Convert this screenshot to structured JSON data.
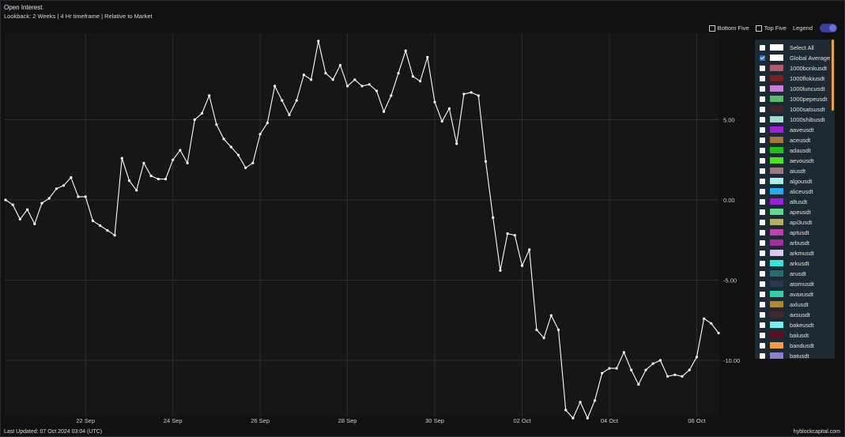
{
  "header": {
    "title": "Open Interest",
    "subtitle": "Lookback: 2 Weeks | 4 Hr timeframe | Relative to Market"
  },
  "controls": {
    "bottom_five": "Bottom Five",
    "top_five": "Top Five",
    "legend": "Legend",
    "legend_toggle_on": true
  },
  "footer": {
    "last_updated": "Last Updated: 07 Oct 2024 03:04 (UTC)",
    "brand": "hyblockcapital.com"
  },
  "legend_items": [
    {
      "label": "Select All",
      "color": "#ffffff",
      "checked": false
    },
    {
      "label": "Global Average",
      "color": "#ffffff",
      "checked": true
    },
    {
      "label": "1000bonkusdt",
      "color": "#b05a6a",
      "checked": false
    },
    {
      "label": "1000flokiusdt",
      "color": "#7a2020",
      "checked": false
    },
    {
      "label": "1000luncusdt",
      "color": "#d07ad8",
      "checked": false
    },
    {
      "label": "1000pepeusdt",
      "color": "#5cb86a",
      "checked": false
    },
    {
      "label": "1000satsusdt",
      "color": "#3a2a2a",
      "checked": false
    },
    {
      "label": "1000shibusdt",
      "color": "#a6d8d0",
      "checked": false
    },
    {
      "label": "aaveusdt",
      "color": "#a020e0",
      "checked": false
    },
    {
      "label": "aceusdt",
      "color": "#a07840",
      "checked": false
    },
    {
      "label": "adausdt",
      "color": "#20c020",
      "checked": false
    },
    {
      "label": "aevousdt",
      "color": "#50e020",
      "checked": false
    },
    {
      "label": "aiusdt",
      "color": "#a07880",
      "checked": false
    },
    {
      "label": "algousdt",
      "color": "#a8f0e8",
      "checked": false
    },
    {
      "label": "aliceusdt",
      "color": "#20b0f0",
      "checked": false
    },
    {
      "label": "altusdt",
      "color": "#9a20e0",
      "checked": false
    },
    {
      "label": "apeusdt",
      "color": "#60d890",
      "checked": false
    },
    {
      "label": "api3usdt",
      "color": "#b0b060",
      "checked": false
    },
    {
      "label": "aptusdt",
      "color": "#c040b0",
      "checked": false
    },
    {
      "label": "arbusdt",
      "color": "#a030a0",
      "checked": false
    },
    {
      "label": "arkmusdt",
      "color": "#d8c8f0",
      "checked": false
    },
    {
      "label": "arkusdt",
      "color": "#30e8e0",
      "checked": false
    },
    {
      "label": "arusdt",
      "color": "#2a6a70",
      "checked": false
    },
    {
      "label": "atomusdt",
      "color": "#2a3a50",
      "checked": false
    },
    {
      "label": "avaxusdt",
      "color": "#30d0a8",
      "checked": false
    },
    {
      "label": "axlusdt",
      "color": "#b08a30",
      "checked": false
    },
    {
      "label": "axsusdt",
      "color": "#402a30",
      "checked": false
    },
    {
      "label": "bakeusdt",
      "color": "#70f0f0",
      "checked": false
    },
    {
      "label": "balusdt",
      "color": "#5a1020",
      "checked": false
    },
    {
      "label": "bandusdt",
      "color": "#f0a040",
      "checked": false
    },
    {
      "label": "batusdt",
      "color": "#8a80d0",
      "checked": false
    }
  ],
  "chart_data": {
    "type": "line",
    "title": "Open Interest",
    "subtitle": "Lookback: 2 Weeks | 4 Hr timeframe | Relative to Market",
    "xlabel": "",
    "ylabel": "",
    "ylim": [
      -13.5,
      10
    ],
    "y_ticks": [
      5,
      0,
      -5,
      -10
    ],
    "y_tick_labels": [
      "5.00",
      "0.00",
      "-5.00",
      "-10.00"
    ],
    "x_tick_labels": [
      "22 Sep",
      "24 Sep",
      "26 Sep",
      "28 Sep",
      "30 Sep",
      "02 Oct",
      "04 Oct",
      "06 Oct"
    ],
    "x_tick_index": [
      11,
      23,
      35,
      47,
      59,
      71,
      83,
      95
    ],
    "grid": true,
    "legend_placement": "right",
    "series": [
      {
        "name": "Global Average",
        "color": "#ffffff",
        "values": [
          0.0,
          -0.3,
          -1.2,
          -0.6,
          -1.5,
          -0.2,
          0.1,
          0.7,
          0.9,
          1.4,
          0.2,
          0.2,
          -1.3,
          -1.6,
          -1.9,
          -2.2,
          2.6,
          1.2,
          0.6,
          2.3,
          1.5,
          1.3,
          1.3,
          2.5,
          3.1,
          2.3,
          5.0,
          5.4,
          6.5,
          4.7,
          3.8,
          3.3,
          2.8,
          2.0,
          2.3,
          4.1,
          4.8,
          7.1,
          6.2,
          5.3,
          6.2,
          7.8,
          7.5,
          9.9,
          7.9,
          7.5,
          8.4,
          7.1,
          7.5,
          7.1,
          7.2,
          6.8,
          5.5,
          6.5,
          7.9,
          9.3,
          7.7,
          7.4,
          8.9,
          6.1,
          4.9,
          5.7,
          3.5,
          6.6,
          6.7,
          6.5,
          2.4,
          -1.1,
          -4.4,
          -2.1,
          -2.2,
          -4.1,
          -3.1,
          -8.1,
          -8.6,
          -7.2,
          -8.1,
          -13.1,
          -13.6,
          -12.6,
          -13.6,
          -12.5,
          -10.8,
          -10.5,
          -10.5,
          -9.5,
          -10.6,
          -11.5,
          -10.6,
          -10.2,
          -10.0,
          -11.0,
          -10.9,
          -11.0,
          -10.6,
          -9.8,
          -7.4,
          -7.7,
          -8.3
        ]
      }
    ]
  }
}
